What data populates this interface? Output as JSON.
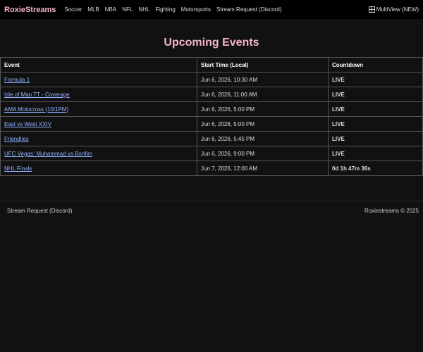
{
  "nav": {
    "brand": "RoxieStreams",
    "items": [
      "Soccer",
      "MLB",
      "NBA",
      "NFL",
      "NHL",
      "Fighting",
      "Motorsports",
      "Stream Request (Discord)"
    ],
    "multiview_label": "MultiView (NEW)",
    "multiview_icon": "grid-icon"
  },
  "main": {
    "title": "Upcoming Events",
    "columns": [
      "Event",
      "Start Time (Local)",
      "Countdown"
    ],
    "rows": [
      {
        "event": "Formula 1",
        "start": "Jun 6, 2026, 10:30 AM",
        "countdown": "LIVE"
      },
      {
        "event": "Isle of Man TT - Coverage",
        "start": "Jun 6, 2026, 11:00 AM",
        "countdown": "LIVE"
      },
      {
        "event": "AMA Motocross (10/1PM)",
        "start": "Jun 6, 2026, 5:00 PM",
        "countdown": "LIVE"
      },
      {
        "event": "East vs West XXIV",
        "start": "Jun 6, 2026, 5:00 PM",
        "countdown": "LIVE"
      },
      {
        "event": "Friendlies",
        "start": "Jun 6, 2026, 5:45 PM",
        "countdown": "LIVE"
      },
      {
        "event": "UFC Vegas: Muhammad vs Bonfim",
        "start": "Jun 6, 2026, 9:00 PM",
        "countdown": "LIVE"
      },
      {
        "event": "NHL Finals",
        "start": "Jun 7, 2026, 12:00 AM",
        "countdown": "0d 1h 47m 36s"
      }
    ]
  },
  "footer": {
    "left": "Stream Request (Discord)",
    "right": "Roxiestreams © 2025"
  },
  "colors": {
    "background": "#111111",
    "navbar": "#000000",
    "brand": "#f4b3c8",
    "link": "#8fb3ff",
    "live": "#e03b2e"
  }
}
